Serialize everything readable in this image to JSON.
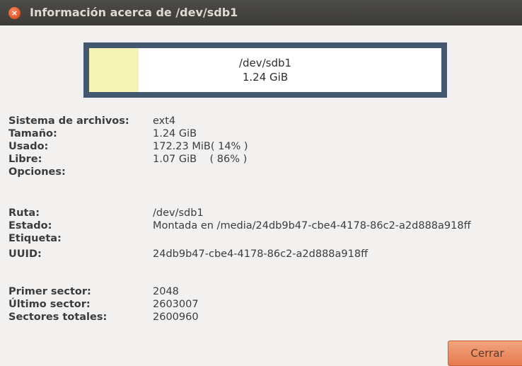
{
  "window": {
    "title": "Información acerca de /dev/sdb1",
    "close_icon": "close-icon"
  },
  "usage_bar": {
    "device": "/dev/sdb1",
    "size": "1.24 GiB",
    "used_fraction": 0.14
  },
  "filesystem": {
    "rows": [
      {
        "label": "Sistema de archivos:",
        "value": "ext4"
      },
      {
        "label": "Tamaño:",
        "value": "1.24 GiB"
      },
      {
        "label": "Usado:",
        "value": "172.23 MiB( 14% )"
      },
      {
        "label": "Libre:",
        "value": "1.07 GiB    ( 86% )"
      },
      {
        "label": "Opciones:",
        "value": ""
      }
    ]
  },
  "partition": {
    "rows": [
      {
        "label": "Ruta:",
        "value": "/dev/sdb1"
      },
      {
        "label": "Estado:",
        "value": "Montada en /media/24db9b47-cbe4-4178-86c2-a2d888a918ff"
      },
      {
        "label": "Etiqueta:",
        "value": ""
      },
      {
        "label": "UUID:",
        "value": "24db9b47-cbe4-4178-86c2-a2d888a918ff"
      }
    ]
  },
  "sectors": {
    "rows": [
      {
        "label": "Primer sector:",
        "value": "2048"
      },
      {
        "label": "Último sector:",
        "value": "2603007"
      },
      {
        "label": "Sectores totales:",
        "value": "2600960"
      }
    ]
  },
  "buttons": {
    "close_label": "Cerrar"
  }
}
